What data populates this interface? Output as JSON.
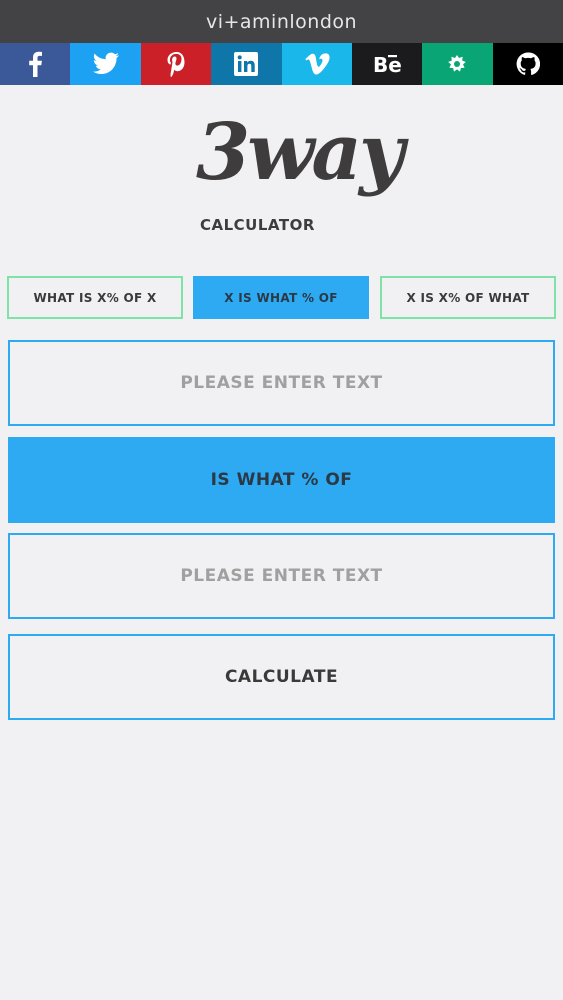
{
  "header": {
    "brand": "vi+aminlondon"
  },
  "social": [
    {
      "name": "facebook",
      "color": "#3b5998"
    },
    {
      "name": "twitter",
      "color": "#1da1f2"
    },
    {
      "name": "pinterest",
      "color": "#cb2027"
    },
    {
      "name": "linkedin",
      "color": "#0e76a8"
    },
    {
      "name": "vimeo",
      "color": "#1ab7ea"
    },
    {
      "name": "behance",
      "color": "#1b1b1d"
    },
    {
      "name": "android",
      "color": "#0aa574"
    },
    {
      "name": "github",
      "color": "#000000"
    }
  ],
  "logo": {
    "big": "3way",
    "small": "CALCULATOR"
  },
  "tabs": [
    {
      "label": "WHAT IS X% OF X",
      "active": false
    },
    {
      "label": "X IS WHAT % OF",
      "active": true
    },
    {
      "label": "X IS X% OF WHAT",
      "active": false
    }
  ],
  "form": {
    "first_placeholder": "PLEASE ENTER TEXT",
    "first_value": "",
    "operator_label": "IS WHAT % OF",
    "second_placeholder": "PLEASE ENTER TEXT",
    "second_value": "",
    "calculate_label": "CALCULATE"
  },
  "colors": {
    "accent": "#2eaaf2",
    "tab_border": "#7fe3a8",
    "topbar": "#434244",
    "background": "#f1f1f3"
  }
}
